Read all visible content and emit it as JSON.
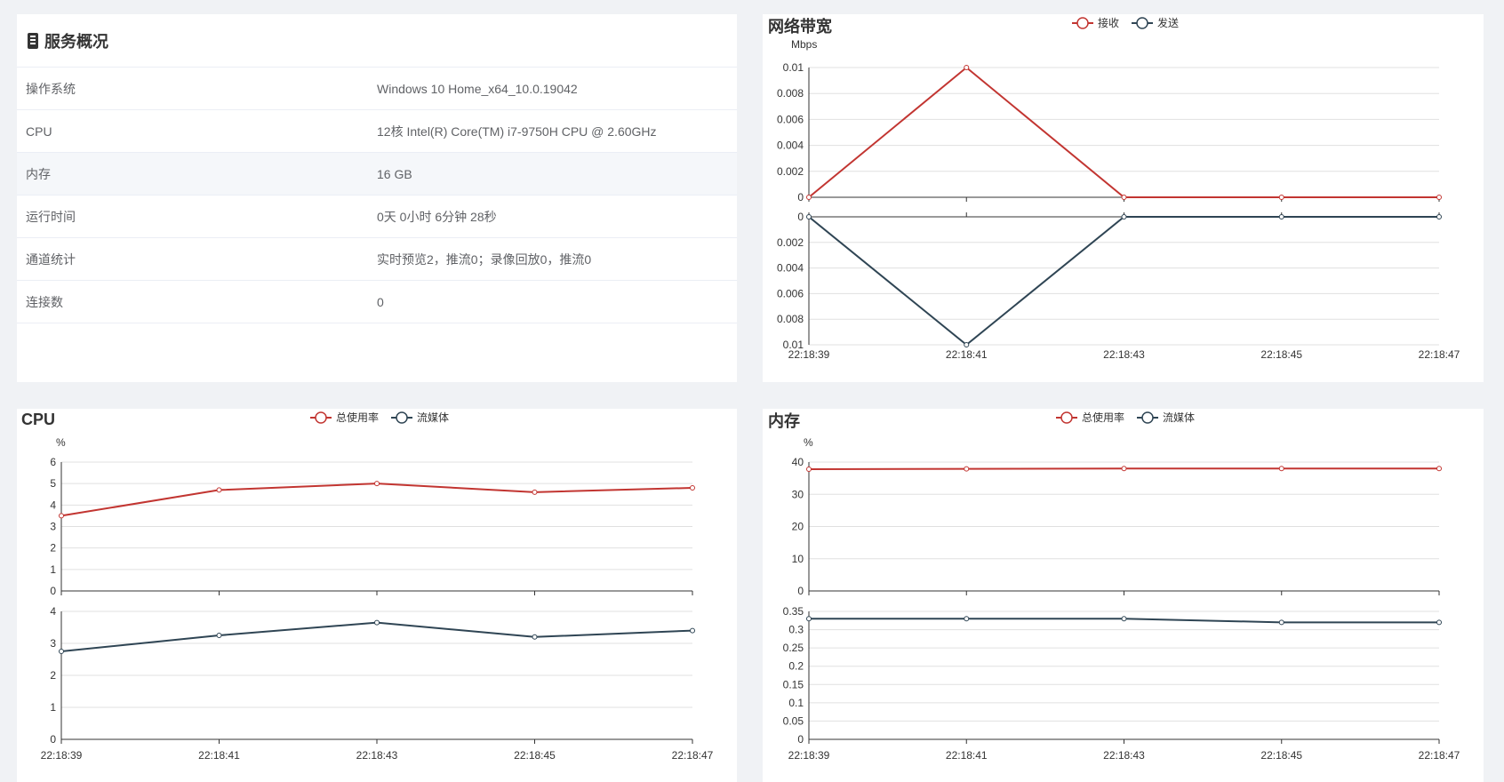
{
  "overview": {
    "title": "服务概况",
    "rows": [
      {
        "label": "操作系统",
        "value": "Windows 10 Home_x64_10.0.19042"
      },
      {
        "label": "CPU",
        "value": "12核 Intel(R) Core(TM) i7-9750H CPU @ 2.60GHz"
      },
      {
        "label": "内存",
        "value": "16 GB"
      },
      {
        "label": "运行时间",
        "value": "0天 0小时 6分钟 28秒"
      },
      {
        "label": "通道统计",
        "value": "实时预览2，推流0；录像回放0，推流0"
      },
      {
        "label": "连接数",
        "value": "0"
      }
    ]
  },
  "colors": {
    "series1": "#c23531",
    "series2": "#2f4554",
    "grid": "#e0e0e0",
    "axis": "#333333"
  },
  "chart_data": [
    {
      "id": "net",
      "type": "line",
      "title": "网络带宽",
      "unit": "Mbps",
      "x": [
        "22:18:39",
        "22:18:41",
        "22:18:43",
        "22:18:45",
        "22:18:47"
      ],
      "top": {
        "name": "接收",
        "values": [
          0,
          0.01,
          0,
          0,
          0
        ],
        "ylim": [
          0,
          0.01
        ],
        "ticks": [
          "0",
          "0.002",
          "0.004",
          "0.006",
          "0.008",
          "0.01"
        ]
      },
      "bottom": {
        "name": "发送",
        "values": [
          0,
          0.01,
          0,
          0,
          0
        ],
        "ylim": [
          0,
          0.01
        ],
        "inverted": true,
        "ticks": [
          "0",
          "0.002",
          "0.004",
          "0.006",
          "0.008",
          "0.01"
        ]
      },
      "legend": "top-center",
      "grid": true
    },
    {
      "id": "cpu",
      "type": "line",
      "title": "CPU",
      "unit": "%",
      "x": [
        "22:18:39",
        "22:18:41",
        "22:18:43",
        "22:18:45",
        "22:18:47"
      ],
      "top": {
        "name": "总使用率",
        "values": [
          3.5,
          4.7,
          5.0,
          4.6,
          4.8
        ],
        "ylim": [
          0,
          6
        ],
        "ticks": [
          "0",
          "1",
          "2",
          "3",
          "4",
          "5",
          "6"
        ]
      },
      "bottom": {
        "name": "流媒体",
        "values": [
          2.75,
          3.25,
          3.65,
          3.2,
          3.4
        ],
        "ylim": [
          0,
          4
        ],
        "ticks": [
          "0",
          "1",
          "2",
          "3",
          "4"
        ]
      },
      "legend": "top-center",
      "grid": true
    },
    {
      "id": "mem",
      "type": "line",
      "title": "内存",
      "unit": "%",
      "x": [
        "22:18:39",
        "22:18:41",
        "22:18:43",
        "22:18:45",
        "22:18:47"
      ],
      "top": {
        "name": "总使用率",
        "values": [
          37.8,
          37.9,
          38.0,
          38.0,
          38.0
        ],
        "ylim": [
          0,
          40
        ],
        "ticks": [
          "0",
          "10",
          "20",
          "30",
          "40"
        ]
      },
      "bottom": {
        "name": "流媒体",
        "values": [
          0.33,
          0.33,
          0.33,
          0.32,
          0.32
        ],
        "ylim": [
          0,
          0.35
        ],
        "ticks": [
          "0",
          "0.05",
          "0.1",
          "0.15",
          "0.2",
          "0.25",
          "0.3",
          "0.35"
        ]
      },
      "legend": "top-center",
      "grid": true
    }
  ]
}
